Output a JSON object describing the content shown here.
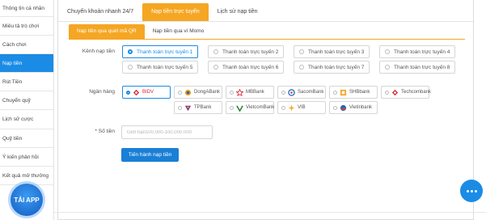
{
  "sidebar": {
    "items": [
      {
        "label": "Thông tin cá nhân"
      },
      {
        "label": "Miêu tả trò chơi"
      },
      {
        "label": "Cách chơi"
      },
      {
        "label": "Nạp tiền"
      },
      {
        "label": "Rút Tiền"
      },
      {
        "label": "Chuyển quỹ"
      },
      {
        "label": "Lịch sử cược"
      },
      {
        "label": "Quỹ tiền"
      },
      {
        "label": "Ý kiến phản hồi"
      },
      {
        "label": "Kết quả mở thưởng"
      }
    ],
    "active_index": 3,
    "app_button": "TẢI APP"
  },
  "tabs": [
    {
      "label": "Chuyển khoản nhanh 24/7"
    },
    {
      "label": "Nạp tiền trực tuyến"
    },
    {
      "label": "Lịch sử nạp tiền"
    }
  ],
  "subtabs": [
    {
      "label": "Nạp tiền qua quét mã QR"
    },
    {
      "label": "Nạp tiền qua ví Momo"
    }
  ],
  "form": {
    "channel_label": "Kênh nạp tiền",
    "channels": [
      "Thanh toán trực tuyến 1",
      "Thanh toán trực tuyến 2",
      "Thanh toán trực tuyến 3",
      "Thanh toán trực tuyến 4",
      "Thanh toán trực tuyến 5",
      "Thanh toán trực tuyến 6",
      "Thanh toán trực tuyến 7",
      "Thanh toán trực tuyến 8"
    ],
    "bank_label": "Ngân hàng",
    "banks": [
      "BIDV",
      "DongABank",
      "MBBank",
      "SacomBank",
      "SHBbank",
      "Techcombank",
      "TPBank",
      "VietcomBank",
      "VIB",
      "Vietinbank"
    ],
    "amount_label": "* Số tiền",
    "amount_placeholder": "Giới hạn100.000-100.000.000",
    "submit_label": "Tiến hành nạp tiền"
  },
  "colors": {
    "accent_orange": "#f5a623",
    "accent_blue": "#1a8ce6",
    "button_blue": "#1a7fd6"
  }
}
